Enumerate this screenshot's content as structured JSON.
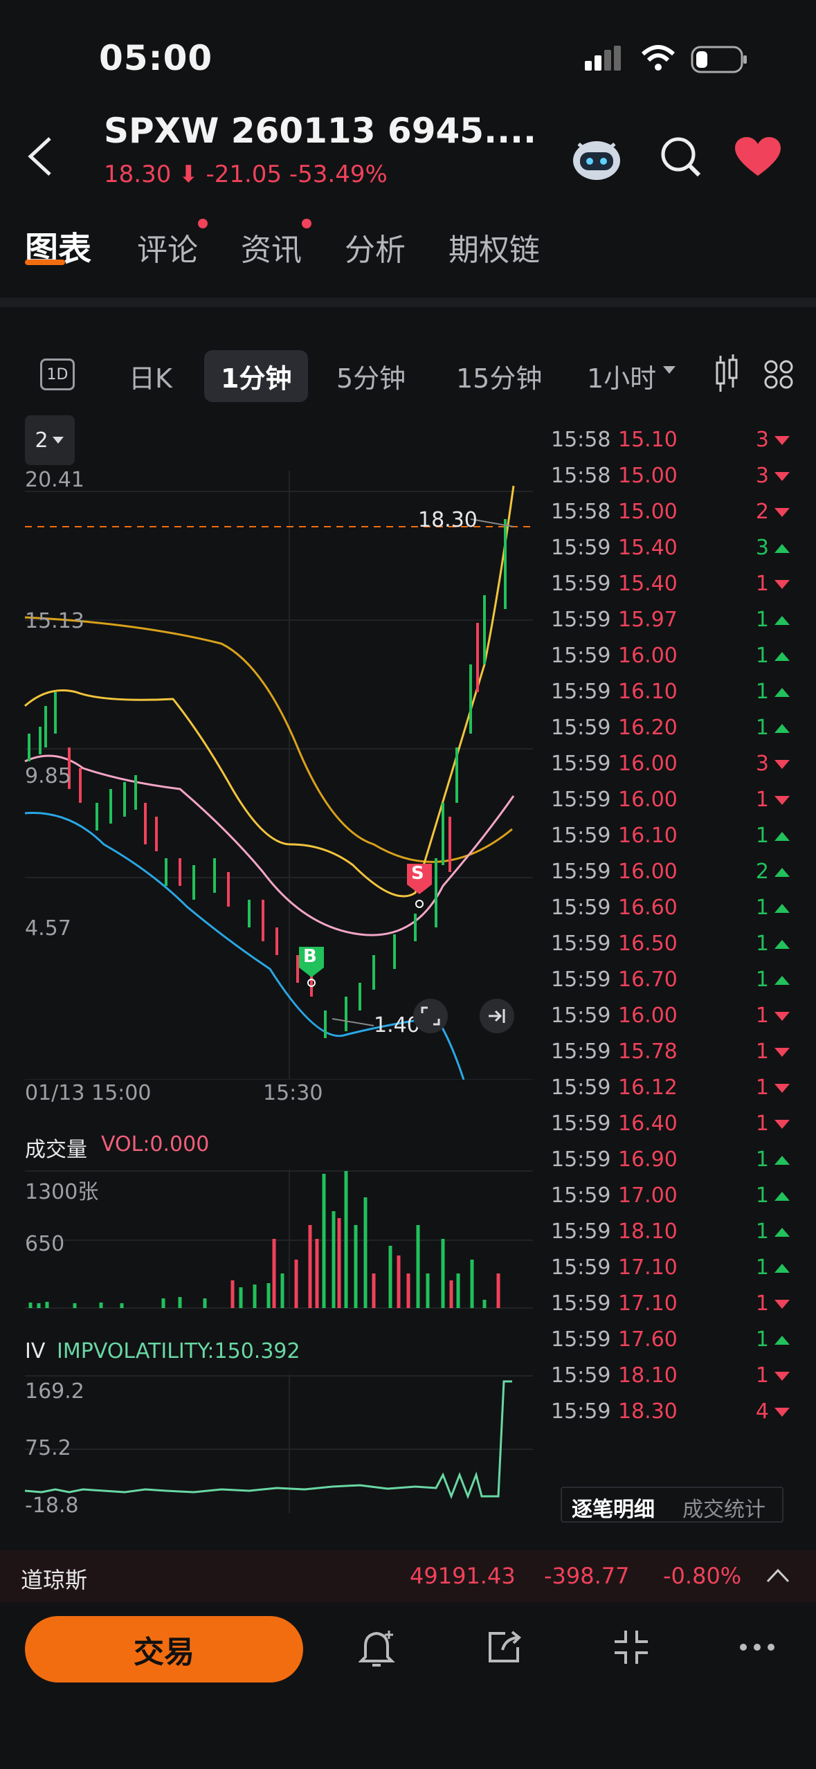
{
  "status_bar": {
    "time": "05:00"
  },
  "header": {
    "title": "SPXW 260113 6945....",
    "price": "18.30",
    "change": "-21.05",
    "change_pct": "-53.49%"
  },
  "tabs": [
    {
      "label": "图表",
      "active": true
    },
    {
      "label": "评论",
      "badge": true
    },
    {
      "label": "资讯",
      "badge": true
    },
    {
      "label": "分析"
    },
    {
      "label": "期权链"
    }
  ],
  "periods": {
    "icon_1d": "1D",
    "items": [
      "日K",
      "1分钟",
      "5分钟",
      "15分钟",
      "1小时"
    ],
    "active": "1分钟"
  },
  "chart": {
    "selector": "2",
    "y_ticks": [
      "20.41",
      "15.13",
      "9.85",
      "4.57"
    ],
    "x_ticks": [
      "01/13 15:00",
      "15:30"
    ],
    "current_price_label": "18.30",
    "low_label": "1.40",
    "buy_marker": "B",
    "sell_marker": "S"
  },
  "volume": {
    "title": "成交量",
    "indicator": "VOL:0.000",
    "ticks": [
      "1300张",
      "650"
    ]
  },
  "iv": {
    "title": "IV",
    "indicator": "IMPVOLATILITY:150.392",
    "ticks": [
      "169.2",
      "75.2",
      "-18.8"
    ]
  },
  "trades": [
    {
      "time": "15:58",
      "price": "15.10",
      "qty": "3",
      "dir": "down"
    },
    {
      "time": "15:58",
      "price": "15.00",
      "qty": "3",
      "dir": "down"
    },
    {
      "time": "15:58",
      "price": "15.00",
      "qty": "2",
      "dir": "down"
    },
    {
      "time": "15:59",
      "price": "15.40",
      "qty": "3",
      "dir": "up"
    },
    {
      "time": "15:59",
      "price": "15.40",
      "qty": "1",
      "dir": "down"
    },
    {
      "time": "15:59",
      "price": "15.97",
      "qty": "1",
      "dir": "up"
    },
    {
      "time": "15:59",
      "price": "16.00",
      "qty": "1",
      "dir": "up"
    },
    {
      "time": "15:59",
      "price": "16.10",
      "qty": "1",
      "dir": "up"
    },
    {
      "time": "15:59",
      "price": "16.20",
      "qty": "1",
      "dir": "up"
    },
    {
      "time": "15:59",
      "price": "16.00",
      "qty": "3",
      "dir": "down"
    },
    {
      "time": "15:59",
      "price": "16.00",
      "qty": "1",
      "dir": "down"
    },
    {
      "time": "15:59",
      "price": "16.10",
      "qty": "1",
      "dir": "up"
    },
    {
      "time": "15:59",
      "price": "16.00",
      "qty": "2",
      "dir": "up"
    },
    {
      "time": "15:59",
      "price": "16.60",
      "qty": "1",
      "dir": "up"
    },
    {
      "time": "15:59",
      "price": "16.50",
      "qty": "1",
      "dir": "up"
    },
    {
      "time": "15:59",
      "price": "16.70",
      "qty": "1",
      "dir": "up"
    },
    {
      "time": "15:59",
      "price": "16.00",
      "qty": "1",
      "dir": "down"
    },
    {
      "time": "15:59",
      "price": "15.78",
      "qty": "1",
      "dir": "down"
    },
    {
      "time": "15:59",
      "price": "16.12",
      "qty": "1",
      "dir": "down"
    },
    {
      "time": "15:59",
      "price": "16.40",
      "qty": "1",
      "dir": "down"
    },
    {
      "time": "15:59",
      "price": "16.90",
      "qty": "1",
      "dir": "up"
    },
    {
      "time": "15:59",
      "price": "17.00",
      "qty": "1",
      "dir": "up"
    },
    {
      "time": "15:59",
      "price": "18.10",
      "qty": "1",
      "dir": "up"
    },
    {
      "time": "15:59",
      "price": "17.10",
      "qty": "1",
      "dir": "up"
    },
    {
      "time": "15:59",
      "price": "17.10",
      "qty": "1",
      "dir": "down"
    },
    {
      "time": "15:59",
      "price": "17.60",
      "qty": "1",
      "dir": "up"
    },
    {
      "time": "15:59",
      "price": "18.10",
      "qty": "1",
      "dir": "down"
    },
    {
      "time": "15:59",
      "price": "18.30",
      "qty": "4",
      "dir": "down"
    }
  ],
  "trade_tabs": [
    "逐笔明细",
    "成交统计"
  ],
  "index_bar": {
    "name": "道琼斯",
    "value": "49191.43",
    "change": "-398.77",
    "pct": "-0.80%"
  },
  "bottom": {
    "trade_label": "交易"
  },
  "colors": {
    "up": "#21c15b",
    "down": "#f0425a",
    "accent": "#f26d10"
  }
}
